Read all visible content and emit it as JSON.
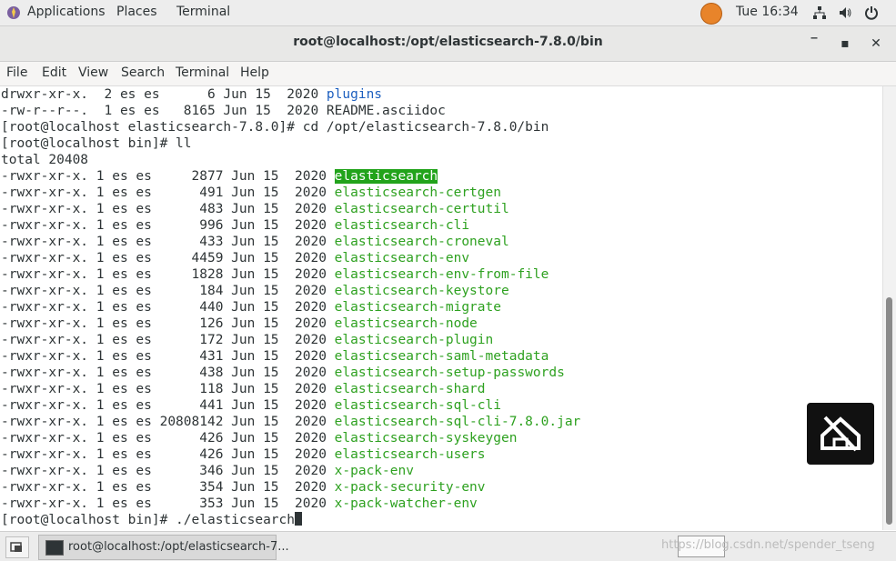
{
  "topbar": {
    "applications": "Applications",
    "places": "Places",
    "terminal": "Terminal",
    "clock": "Tue 16:34",
    "icons": [
      "app-menu-icon",
      "hot-icon",
      "network-icon",
      "volume-icon",
      "power-icon"
    ]
  },
  "window": {
    "title": "root@localhost:/opt/elasticsearch-7.8.0/bin",
    "minimize": "‾",
    "maximize": "▪",
    "close": "✕"
  },
  "menu": {
    "file": "File",
    "edit": "Edit",
    "view": "View",
    "search": "Search",
    "terminal": "Terminal",
    "help": "Help"
  },
  "terminal": {
    "pre": [
      {
        "prefix": "drwxr-xr-x.  2 es es      6 Jun 15  2020 ",
        "name": "plugins",
        "style": "blue"
      },
      {
        "prefix": "-rw-r--r--.  1 es es   8165 Jun 15  2020 ",
        "name": "README.asciidoc",
        "style": "plain"
      }
    ],
    "cmd1": "[root@localhost elasticsearch-7.8.0]# cd /opt/elasticsearch-7.8.0/bin",
    "cmd2": "[root@localhost bin]# ll",
    "total": "total 20408",
    "files": [
      {
        "prefix": "-rwxr-xr-x. 1 es es     2877 Jun 15  2020 ",
        "name": "elasticsearch",
        "style": "hl"
      },
      {
        "prefix": "-rwxr-xr-x. 1 es es      491 Jun 15  2020 ",
        "name": "elasticsearch-certgen",
        "style": "green"
      },
      {
        "prefix": "-rwxr-xr-x. 1 es es      483 Jun 15  2020 ",
        "name": "elasticsearch-certutil",
        "style": "green"
      },
      {
        "prefix": "-rwxr-xr-x. 1 es es      996 Jun 15  2020 ",
        "name": "elasticsearch-cli",
        "style": "green"
      },
      {
        "prefix": "-rwxr-xr-x. 1 es es      433 Jun 15  2020 ",
        "name": "elasticsearch-croneval",
        "style": "green"
      },
      {
        "prefix": "-rwxr-xr-x. 1 es es     4459 Jun 15  2020 ",
        "name": "elasticsearch-env",
        "style": "green"
      },
      {
        "prefix": "-rwxr-xr-x. 1 es es     1828 Jun 15  2020 ",
        "name": "elasticsearch-env-from-file",
        "style": "green"
      },
      {
        "prefix": "-rwxr-xr-x. 1 es es      184 Jun 15  2020 ",
        "name": "elasticsearch-keystore",
        "style": "green"
      },
      {
        "prefix": "-rwxr-xr-x. 1 es es      440 Jun 15  2020 ",
        "name": "elasticsearch-migrate",
        "style": "green"
      },
      {
        "prefix": "-rwxr-xr-x. 1 es es      126 Jun 15  2020 ",
        "name": "elasticsearch-node",
        "style": "green"
      },
      {
        "prefix": "-rwxr-xr-x. 1 es es      172 Jun 15  2020 ",
        "name": "elasticsearch-plugin",
        "style": "green"
      },
      {
        "prefix": "-rwxr-xr-x. 1 es es      431 Jun 15  2020 ",
        "name": "elasticsearch-saml-metadata",
        "style": "green"
      },
      {
        "prefix": "-rwxr-xr-x. 1 es es      438 Jun 15  2020 ",
        "name": "elasticsearch-setup-passwords",
        "style": "green"
      },
      {
        "prefix": "-rwxr-xr-x. 1 es es      118 Jun 15  2020 ",
        "name": "elasticsearch-shard",
        "style": "green"
      },
      {
        "prefix": "-rwxr-xr-x. 1 es es      441 Jun 15  2020 ",
        "name": "elasticsearch-sql-cli",
        "style": "green"
      },
      {
        "prefix": "-rwxr-xr-x. 1 es es 20808142 Jun 15  2020 ",
        "name": "elasticsearch-sql-cli-7.8.0.jar",
        "style": "green"
      },
      {
        "prefix": "-rwxr-xr-x. 1 es es      426 Jun 15  2020 ",
        "name": "elasticsearch-syskeygen",
        "style": "green"
      },
      {
        "prefix": "-rwxr-xr-x. 1 es es      426 Jun 15  2020 ",
        "name": "elasticsearch-users",
        "style": "green"
      },
      {
        "prefix": "-rwxr-xr-x. 1 es es      346 Jun 15  2020 ",
        "name": "x-pack-env",
        "style": "green"
      },
      {
        "prefix": "-rwxr-xr-x. 1 es es      354 Jun 15  2020 ",
        "name": "x-pack-security-env",
        "style": "green"
      },
      {
        "prefix": "-rwxr-xr-x. 1 es es      353 Jun 15  2020 ",
        "name": "x-pack-watcher-env",
        "style": "green"
      }
    ],
    "prompt": "[root@localhost bin]# ./elasticsearch"
  },
  "taskbar": {
    "item_label": "root@localhost:/opt/elasticsearch-7...",
    "watermark": "https://blog.csdn.net/spender_tseng"
  },
  "colors": {
    "link_blue": "#1c5fbf",
    "exec_green": "#2ea120",
    "highlight_bg": "#22a31b"
  }
}
